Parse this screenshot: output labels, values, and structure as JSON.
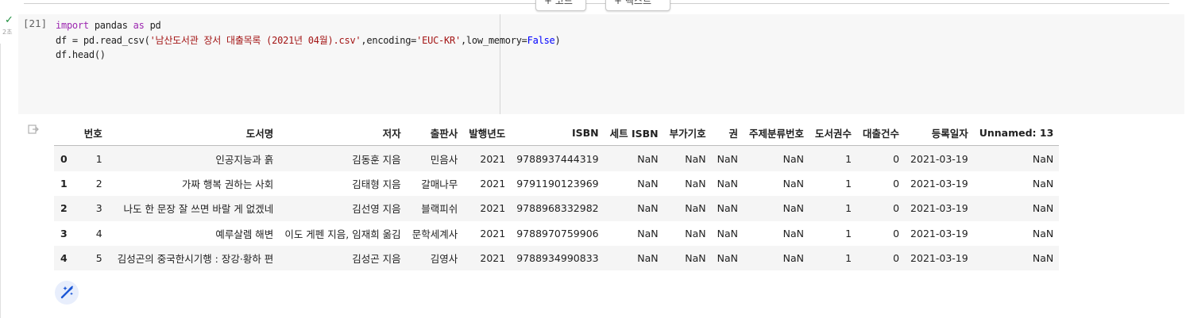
{
  "toolbar": {
    "add_code_label": "+ 코드",
    "add_text_label": "+ 텍스트"
  },
  "cell": {
    "status_icon": "check-icon",
    "exec_time": "2초",
    "exec_count": "[21]",
    "code_lines": [
      {
        "kw": "import",
        "plain1": " pandas ",
        "kw2": "as",
        "plain2": " pd"
      },
      {
        "pre": "df = pd.read_csv(",
        "str1": "'남산도서관 장서 대출목록 (2021년 04월).csv'",
        "mid": ",encoding=",
        "str2": "'EUC-KR'",
        "mid2": ",low_memory=",
        "bool": "False",
        "post": ")"
      },
      {
        "text": "df.head()"
      }
    ]
  },
  "output": {
    "icon": "output-redirect-icon",
    "columns": [
      "",
      "번호",
      "도서명",
      "저자",
      "출판사",
      "발행년도",
      "ISBN",
      "세트 ISBN",
      "부가기호",
      "권",
      "주제분류번호",
      "도서권수",
      "대출건수",
      "등록일자",
      "Unnamed: 13"
    ],
    "rows": [
      [
        "0",
        "1",
        "인공지능과 흙",
        "김동훈 지음",
        "민음사",
        "2021",
        "9788937444319",
        "NaN",
        "NaN",
        "NaN",
        "NaN",
        "1",
        "0",
        "2021-03-19",
        "NaN"
      ],
      [
        "1",
        "2",
        "가짜 행복 권하는 사회",
        "김태형 지음",
        "갈매나무",
        "2021",
        "9791190123969",
        "NaN",
        "NaN",
        "NaN",
        "NaN",
        "1",
        "0",
        "2021-03-19",
        "NaN"
      ],
      [
        "2",
        "3",
        "나도 한 문장 잘 쓰면 바랄 게 없겠네",
        "김선영 지음",
        "블랙피쉬",
        "2021",
        "9788968332982",
        "NaN",
        "NaN",
        "NaN",
        "NaN",
        "1",
        "0",
        "2021-03-19",
        "NaN"
      ],
      [
        "3",
        "4",
        "예루살렘 해변",
        "이도 게펜 지음, 임재희 옮김",
        "문학세계사",
        "2021",
        "9788970759906",
        "NaN",
        "NaN",
        "NaN",
        "NaN",
        "1",
        "0",
        "2021-03-19",
        "NaN"
      ],
      [
        "4",
        "5",
        "김성곤의 중국한시기행 : 장강·황하 편",
        "김성곤 지음",
        "김영사",
        "2021",
        "9788934990833",
        "NaN",
        "NaN",
        "NaN",
        "NaN",
        "1",
        "0",
        "2021-03-19",
        "NaN"
      ]
    ]
  },
  "magic": {
    "icon": "magic-wand-icon"
  }
}
